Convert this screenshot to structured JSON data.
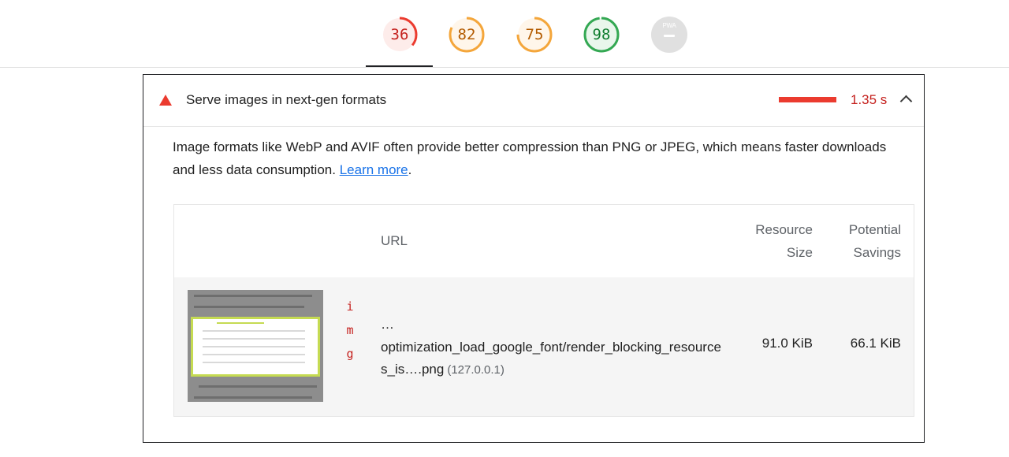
{
  "gauges": [
    {
      "name": "performance",
      "value": "36",
      "score": 0.36,
      "color": "#eb3b2f",
      "bg": "#fdecea"
    },
    {
      "name": "accessibility",
      "value": "82",
      "score": 0.82,
      "color": "#f4a63b",
      "bg": "#fff6ea"
    },
    {
      "name": "best-practices",
      "value": "75",
      "score": 0.75,
      "color": "#f4a63b",
      "bg": "#fff6ea"
    },
    {
      "name": "seo",
      "value": "98",
      "score": 0.98,
      "color": "#34a853",
      "bg": "#e9f6ec"
    },
    {
      "name": "pwa",
      "value": "PWA",
      "score": 0,
      "color": "#bdbdbd",
      "bg": "#e0e0e0"
    }
  ],
  "audit": {
    "title": "Serve images in next-gen formats",
    "savings": "1.35 s",
    "description": "Image formats like WebP and AVIF often provide better compression than PNG or JPEG, which means faster downloads and less data consumption.",
    "learn_more": "Learn more",
    "period": "."
  },
  "table": {
    "headers": {
      "url": "URL",
      "size_line1": "Resource",
      "size_line2": "Size",
      "savings_line1": "Potential",
      "savings_line2": "Savings"
    },
    "rows": [
      {
        "type": "img",
        "url_prefix": "…",
        "url": "optimization_load_google_font/render_blocking_resources_is….png",
        "host": "(127.0.0.1)",
        "size": "91.0 KiB",
        "savings": "66.1 KiB"
      }
    ]
  },
  "colors": {
    "fail": "#eb3b2f",
    "link": "#1a73e8"
  }
}
